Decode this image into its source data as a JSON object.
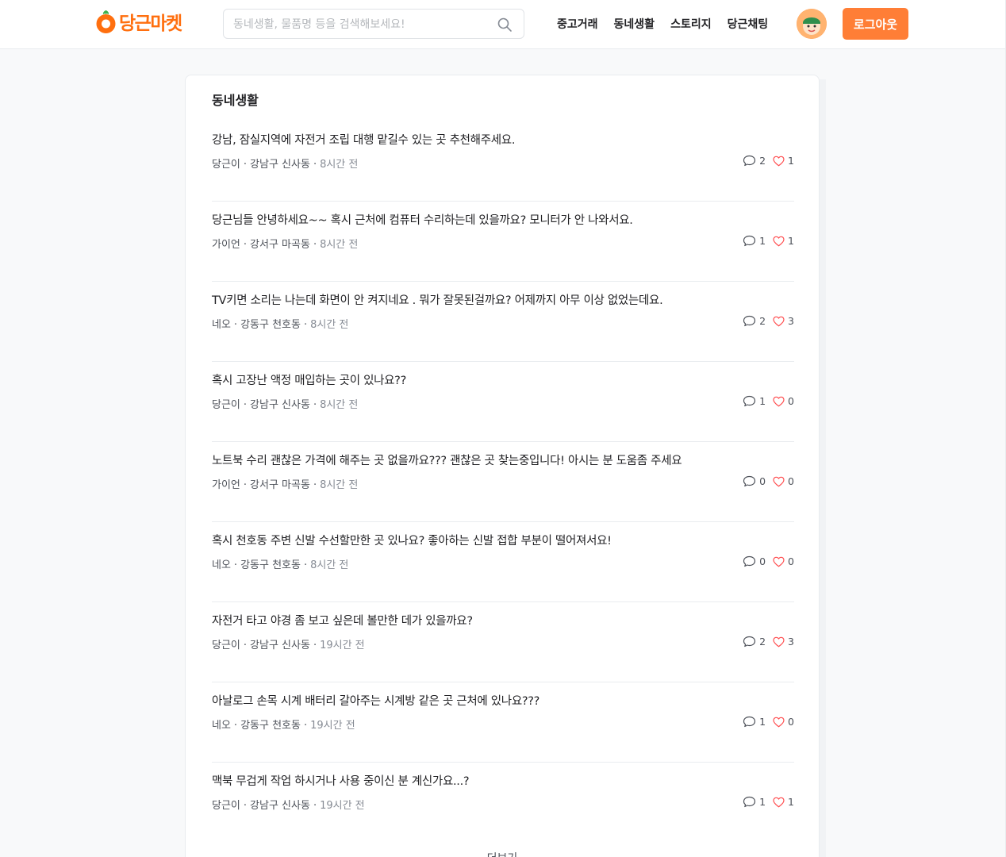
{
  "header": {
    "logo_text": "당근마켓",
    "search_placeholder": "동네생활, 물품명 등을 검색해보세요!",
    "search_value": "",
    "nav": [
      "중고거래",
      "동네생활",
      "스토리지",
      "당근채팅"
    ],
    "logout_label": "로그아웃"
  },
  "colors": {
    "brand": "#ff6f0f",
    "button": "#ff7e36",
    "heart": "#ff4d4f"
  },
  "section": {
    "title": "동네생활"
  },
  "posts": [
    {
      "title": "강남, 잠실지역에 자전거 조립 대행 맡길수 있는 곳 추천해주세요.",
      "author": "당근이",
      "location": "강남구 신사동",
      "time": "8시간 전",
      "comments": "2",
      "likes": "1"
    },
    {
      "title": "당근님들 안녕하세요~~ 혹시 근처에 컴퓨터 수리하는데 있을까요? 모니터가 안 나와서요.",
      "author": "가이언",
      "location": "강서구 마곡동",
      "time": "8시간 전",
      "comments": "1",
      "likes": "1"
    },
    {
      "title": "TV키면 소리는 나는데 화면이 안 켜지네요 . 뭐가 잘못된걸까요? 어제까지 아무 이상 없었는데요.",
      "author": "네오",
      "location": "강동구 천호동",
      "time": "8시간 전",
      "comments": "2",
      "likes": "3"
    },
    {
      "title": "혹시 고장난 액정 매입하는 곳이 있나요??",
      "author": "당근이",
      "location": "강남구 신사동",
      "time": "8시간 전",
      "comments": "1",
      "likes": "0"
    },
    {
      "title": "노트북 수리 괜찮은 가격에 해주는 곳 없을까요??? 괜찮은 곳 찾는중입니다! 아시는 분 도움좀 주세요",
      "author": "가이언",
      "location": "강서구 마곡동",
      "time": "8시간 전",
      "comments": "0",
      "likes": "0"
    },
    {
      "title": "혹시  천호동 주변 신발 수선할만한 곳 있나요? 좋아하는  신발 접합 부분이 떨어져서요!",
      "author": "네오",
      "location": "강동구 천호동",
      "time": "8시간 전",
      "comments": "0",
      "likes": "0"
    },
    {
      "title": "자전거 타고 야경 좀 보고 싶은데 볼만한 데가 있을까요?",
      "author": "당근이",
      "location": "강남구 신사동",
      "time": "19시간 전",
      "comments": "2",
      "likes": "3"
    },
    {
      "title": "아날로그 손목 시계 배터리 갈아주는 시계방 같은 곳 근처에 있나요???",
      "author": "네오",
      "location": "강동구 천호동",
      "time": "19시간 전",
      "comments": "1",
      "likes": "0"
    },
    {
      "title": "맥북 무겁게 작업 하시거나 사용 중이신 분 계신가요...?",
      "author": "당근이",
      "location": "강남구 신사동",
      "time": "19시간 전",
      "comments": "1",
      "likes": "1"
    }
  ],
  "more_label": "더보기",
  "icons": {
    "logo": "carrot-icon",
    "search": "search-icon",
    "comment": "comment-icon",
    "like": "heart-icon",
    "avatar": "avatar-icon"
  }
}
